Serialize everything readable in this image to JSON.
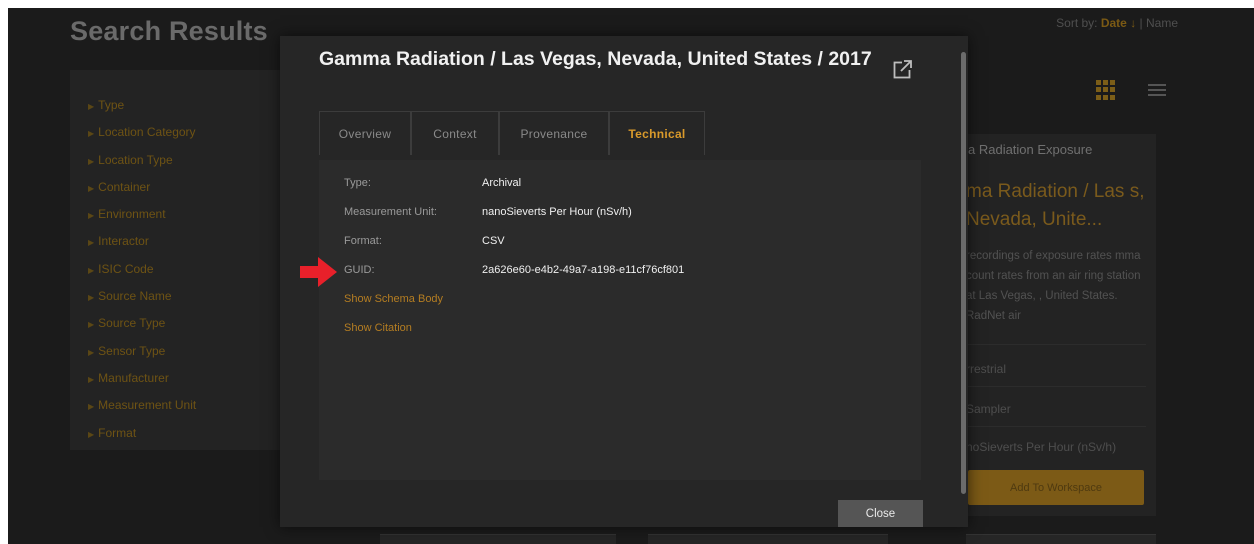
{
  "background": {
    "page_title": "Search Results",
    "sort_label": "Sort by:",
    "sort_active": "Date ↓",
    "sort_separator": " | ",
    "sort_other": "Name",
    "filters": [
      "Type",
      "Location Category",
      "Location Type",
      "Container",
      "Environment",
      "Interactor",
      "ISIC Code",
      "Source Name",
      "Source Type",
      "Sensor Type",
      "Manufacturer",
      "Measurement Unit",
      "Format"
    ],
    "result_card": {
      "type_label": "a Radiation Exposure",
      "title": "ma Radiation / Las s, Nevada, Unite...",
      "description": "recordings of exposure rates mma count rates from an air ring station at Las Vegas, , United States. RadNet air",
      "fields": [
        "rrestrial",
        "Sampler",
        "noSieverts Per Hour (nSv/h)"
      ],
      "add_button": "Add To Workspace"
    }
  },
  "modal": {
    "title": "Gamma Radiation / Las Vegas, Nevada, United States / 2017",
    "tabs": [
      "Overview",
      "Context",
      "Provenance",
      "Technical"
    ],
    "active_tab": "Technical",
    "rows": [
      {
        "label": "Type:",
        "value": "Archival"
      },
      {
        "label": "Measurement Unit:",
        "value": "nanoSieverts Per Hour (nSv/h)"
      },
      {
        "label": "Format:",
        "value": "CSV"
      },
      {
        "label": "GUID:",
        "value": "2a626e60-e4b2-49a7-a198-e11cf76cf801"
      }
    ],
    "links": [
      "Show Schema Body",
      "Show Citation"
    ],
    "close_label": "Close"
  },
  "colors": {
    "accent": "#d99a2b",
    "annotation_arrow": "#e8202a",
    "modal_bg": "#262626"
  },
  "icons": {
    "external": "external-link-icon",
    "grid_view": "grid-view-icon",
    "list_view": "list-view-icon",
    "annotation": "red-arrow-icon"
  }
}
